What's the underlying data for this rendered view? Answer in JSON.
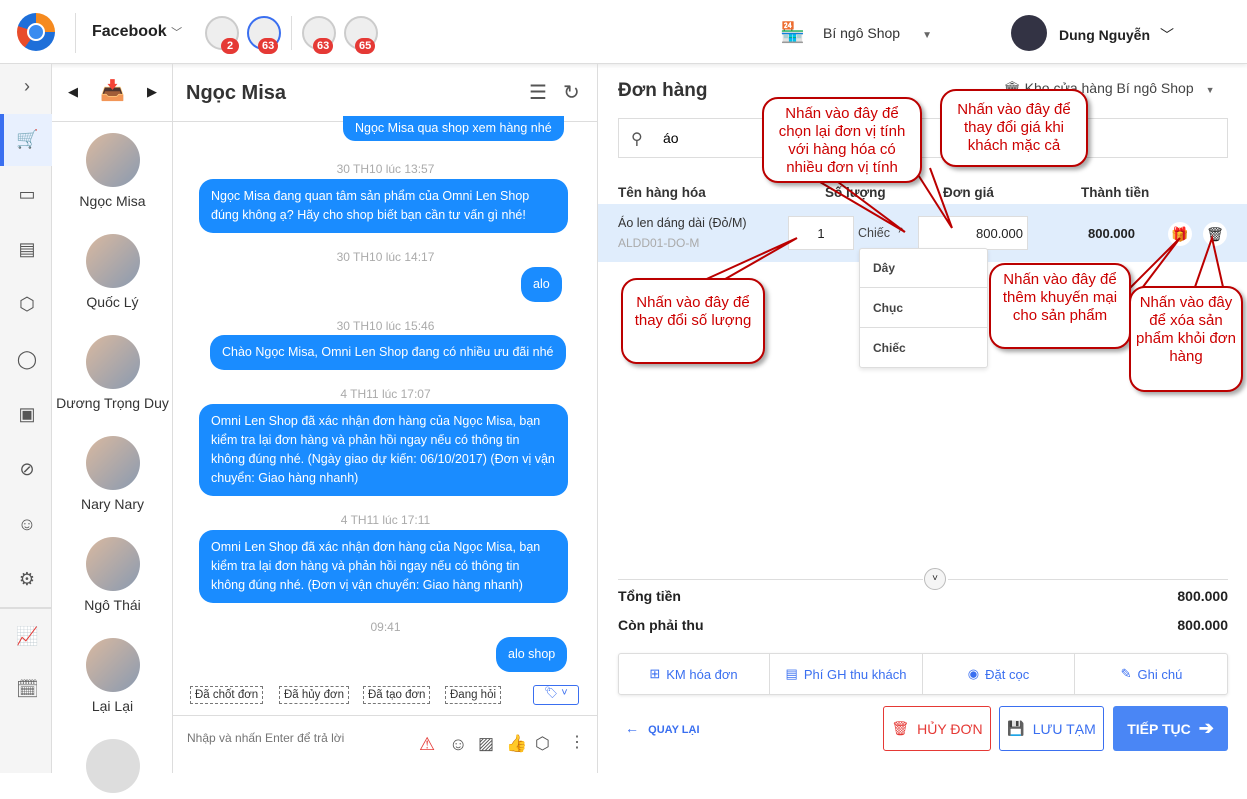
{
  "topbar": {
    "channel": "Facebook",
    "badges": [
      "2",
      "63",
      "63",
      "65"
    ],
    "shop": "Bí ngô Shop",
    "user": "Dung Nguyễn"
  },
  "contacts": [
    "Ngọc Misa",
    "Quốc Lý",
    "Dương Trọng Duy",
    "Nary Nary",
    "Ngô Thái",
    "Lại Lại"
  ],
  "chat": {
    "title": "Ngọc Misa",
    "messages": [
      {
        "time": "",
        "text": "Ngọc Misa qua shop xem hàng nhé"
      },
      {
        "time": "30 TH10 lúc 13:57",
        "text": "Ngọc Misa đang quan tâm sản phẩm của Omni Len Shop đúng không ạ? Hãy cho shop biết bạn cần tư vấn gì nhé!"
      },
      {
        "time": "30 TH10 lúc 14:17",
        "text": "alo"
      },
      {
        "time": "30 TH10 lúc 15:46",
        "text": "Chào Ngọc Misa, Omni Len Shop đang có nhiều ưu đãi nhé"
      },
      {
        "time": "4 TH11 lúc 17:07",
        "text": "Omni Len Shop đã xác nhận đơn hàng của Ngọc Misa, bạn kiểm tra lại đơn hàng và phản hồi ngay nếu có thông tin không đúng nhé. (Ngày giao dự kiến:  06/10/2017) (Đơn vị vận chuyển:  Giao hàng nhanh)"
      },
      {
        "time": "4 TH11 lúc 17:11",
        "text": "Omni Len Shop đã xác nhận đơn hàng của Ngọc Misa, bạn kiểm tra lại đơn hàng và phản hồi ngay nếu có thông tin không đúng nhé. (Đơn vị vận chuyển:  Giao hàng nhanh)"
      },
      {
        "time": "09:41",
        "text": "alo shop"
      }
    ],
    "tags": [
      "Đã chốt đơn",
      "Đã hủy đơn",
      "Đã tạo đơn",
      "Đang hỏi"
    ],
    "input_placeholder": "Nhập và nhấn Enter để trả lời"
  },
  "order": {
    "title": "Đơn hàng",
    "warehouse": "Kho cửa hàng Bí ngô Shop",
    "search": "áo",
    "headers": [
      "Tên hàng hóa",
      "Số lượng",
      "Đơn giá",
      "Thành tiền"
    ],
    "item": {
      "name": "Áo len dáng dài (Đỏ/M)",
      "code": "ALDD01-DO-M",
      "qty": "1",
      "unit": "Chiếc",
      "price": "800.000",
      "total": "800.000"
    },
    "units": [
      "Dây",
      "Chục",
      "Chiếc"
    ],
    "total_label": "Tổng tiền",
    "total": "800.000",
    "due_label": "Còn phải thu",
    "due": "800.000",
    "footer_buttons": [
      "KM hóa đơn",
      "Phí GH thu khách",
      "Đặt cọc",
      "Ghi chú"
    ],
    "back": "QUAY LẠI",
    "cancel": "HỦY ĐƠN",
    "save": "LƯU TẠM",
    "next": "TIẾP TỤC"
  },
  "callouts": [
    "Nhấn vào đây để chọn lại đơn vị tính với hàng hóa có nhiều đơn vị tính",
    "Nhấn vào đây để thay đổi giá khi khách mặc cả",
    "Nhấn vào đây để thay đổi số lượng",
    "Nhấn vào đây để thêm khuyến mại cho sản phẩm",
    "Nhấn vào đây để xóa sản phẩm khỏi đơn hàng"
  ]
}
